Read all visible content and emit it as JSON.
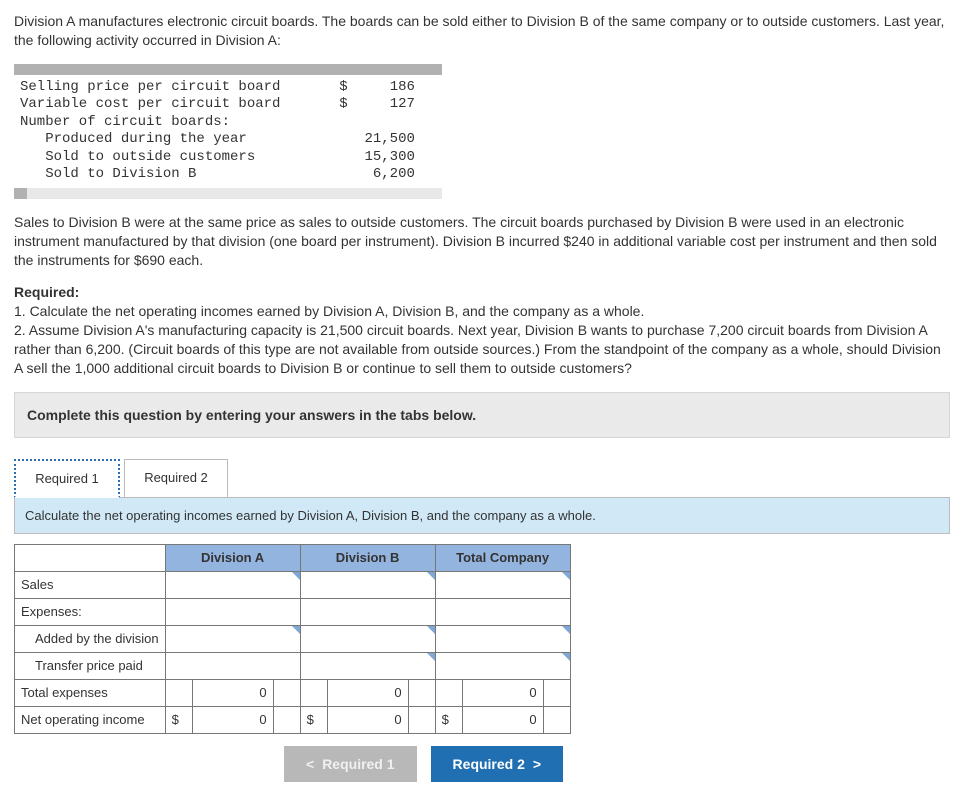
{
  "intro": "Division A manufactures electronic circuit boards. The boards can be sold either to Division B of the same company or to outside customers. Last year, the following activity occurred in Division A:",
  "mono": {
    "r1_label": "Selling price per circuit board",
    "r1_sym": "$",
    "r1_val": "186",
    "r2_label": "Variable cost per circuit board",
    "r2_sym": "$",
    "r2_val": "127",
    "r3_label": "Number of circuit boards:",
    "r4_label": "   Produced during the year",
    "r4_val": "21,500",
    "r5_label": "   Sold to outside customers",
    "r5_val": "15,300",
    "r6_label": "   Sold to Division B",
    "r6_val": "6,200"
  },
  "midtext": "Sales to Division B were at the same price as sales to outside customers. The circuit boards purchased by Division B were used in an electronic instrument manufactured by that division (one board per instrument). Division B incurred $240 in additional variable cost per instrument and then sold the instruments for $690 each.",
  "required": {
    "heading": "Required:",
    "item1": "1. Calculate the net operating incomes earned by Division A, Division B, and the company as a whole.",
    "item2": "2. Assume Division A's manufacturing capacity is 21,500 circuit boards. Next year, Division B wants to purchase 7,200 circuit boards from Division A rather than 6,200. (Circuit boards of this type are not available from outside sources.) From the standpoint of the company as a whole, should Division A sell the 1,000 additional circuit boards to Division B or continue to sell them to outside customers?"
  },
  "instr_bar": "Complete this question by entering your answers in the tabs below.",
  "tabs": {
    "t1": "Required 1",
    "t2": "Required 2"
  },
  "sub_instr": "Calculate the net operating incomes earned by Division A, Division B, and the company as a whole.",
  "headers": {
    "c1": "Division A",
    "c2": "Division B",
    "c3": "Total Company"
  },
  "rows": {
    "sales": "Sales",
    "expenses": "Expenses:",
    "added": "Added by the division",
    "transfer": "Transfer price paid",
    "total": "Total expenses",
    "noi": "Net operating income"
  },
  "vals": {
    "dollar": "$",
    "zero": "0"
  },
  "nav": {
    "prev": "Required 1",
    "next": "Required 2"
  }
}
